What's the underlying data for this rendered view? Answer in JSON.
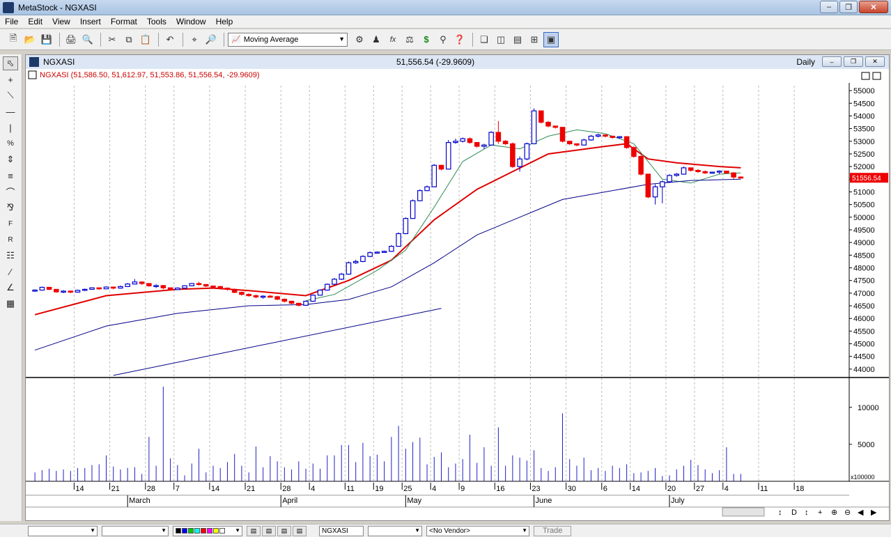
{
  "window": {
    "title": "MetaStock - NGXASI"
  },
  "menu": [
    "File",
    "Edit",
    "View",
    "Insert",
    "Format",
    "Tools",
    "Window",
    "Help"
  ],
  "toolbar": {
    "indicator_select": "Moving Average"
  },
  "chart_window": {
    "name": "NGXASI",
    "last_value": "51,556.54 (-29.9609)",
    "period": "Daily",
    "price_header": "NGXASI (51,586.50, 51,612.97, 51,553.86, 51,556.54, -29.9609)",
    "last_price_tag": "51556.54",
    "volume_scale": "x100000"
  },
  "bottom": {
    "symbol": "NGXASI",
    "vendor": "<No Vendor>",
    "trade": "Trade"
  },
  "colors": {
    "up": "#0000cc",
    "down": "#ee0000",
    "ma_red": "#e00000",
    "ma_green": "#2e8b57",
    "ma_blue": "#000088",
    "volume": "#1f1fc8"
  },
  "chart_data": {
    "type": "candlestick",
    "price_axis": {
      "min": 43750,
      "max": 55250,
      "ticks": [
        44000,
        44500,
        45000,
        45500,
        46000,
        46500,
        47000,
        47500,
        48000,
        48500,
        49000,
        49500,
        50000,
        50500,
        51000,
        51500,
        52000,
        52500,
        53000,
        53500,
        54000,
        54500,
        55000
      ]
    },
    "volume_axis": {
      "min": 0,
      "max": 13000,
      "ticks": [
        5000,
        10000
      ]
    },
    "day_labels": [
      "14",
      "21",
      "28",
      "7",
      "14",
      "21",
      "28",
      "4",
      "11",
      "19",
      "25",
      "4",
      "9",
      "16",
      "23",
      "30",
      "6",
      "14",
      "20",
      "27",
      "4",
      "11",
      "18"
    ],
    "month_labels": [
      "March",
      "April",
      "May",
      "June",
      "July"
    ],
    "candles": [
      [
        47080,
        47150,
        47050,
        47120,
        1200
      ],
      [
        47120,
        47260,
        47100,
        47230,
        1500
      ],
      [
        47230,
        47240,
        47120,
        47150,
        1700
      ],
      [
        47150,
        47160,
        47020,
        47050,
        1400
      ],
      [
        47050,
        47120,
        47000,
        47080,
        1600
      ],
      [
        47080,
        47100,
        47000,
        47040,
        1400
      ],
      [
        47040,
        47140,
        47020,
        47110,
        1800
      ],
      [
        47110,
        47180,
        47080,
        47150,
        1800
      ],
      [
        47150,
        47230,
        47130,
        47210,
        2200
      ],
      [
        47210,
        47220,
        47130,
        47170,
        2300
      ],
      [
        47170,
        47270,
        47160,
        47240,
        3500
      ],
      [
        47240,
        47260,
        47150,
        47200,
        2000
      ],
      [
        47200,
        47300,
        47180,
        47260,
        1600
      ],
      [
        47260,
        47400,
        47240,
        47360,
        1800
      ],
      [
        47360,
        47560,
        47340,
        47440,
        1900
      ],
      [
        47440,
        47460,
        47320,
        47380,
        1000
      ],
      [
        47380,
        47390,
        47250,
        47290,
        6000
      ],
      [
        47290,
        47350,
        47200,
        47300,
        2100
      ],
      [
        47300,
        47320,
        47150,
        47210,
        12800
      ],
      [
        47210,
        47220,
        47100,
        47140,
        3100
      ],
      [
        47140,
        47230,
        47120,
        47200,
        2200
      ],
      [
        47200,
        47310,
        47170,
        47290,
        800
      ],
      [
        47290,
        47400,
        47270,
        47380,
        2400
      ],
      [
        47380,
        47450,
        47300,
        47340,
        4400
      ],
      [
        47340,
        47360,
        47240,
        47280,
        1200
      ],
      [
        47280,
        47300,
        47200,
        47260,
        2100
      ],
      [
        47260,
        47290,
        47150,
        47200,
        1800
      ],
      [
        47200,
        47220,
        47100,
        47150,
        2600
      ],
      [
        47150,
        47180,
        47000,
        47030,
        3700
      ],
      [
        47030,
        47060,
        46900,
        46950,
        2100
      ],
      [
        46950,
        47000,
        46860,
        46900,
        1200
      ],
      [
        46900,
        46950,
        46800,
        46850,
        4700
      ],
      [
        46850,
        46920,
        46780,
        46880,
        1900
      ],
      [
        46880,
        46930,
        46820,
        46860,
        3400
      ],
      [
        46860,
        46900,
        46720,
        46760,
        2700
      ],
      [
        46760,
        46790,
        46630,
        46680,
        1900
      ],
      [
        46680,
        46700,
        46560,
        46600,
        1600
      ],
      [
        46600,
        46620,
        46480,
        46520,
        2700
      ],
      [
        46520,
        46700,
        46500,
        46680,
        1700
      ],
      [
        46680,
        46950,
        46660,
        46920,
        2400
      ],
      [
        46920,
        47150,
        46900,
        47120,
        1700
      ],
      [
        47120,
        47380,
        47100,
        47350,
        3500
      ],
      [
        47350,
        47600,
        47330,
        47550,
        3500
      ],
      [
        47550,
        47800,
        47520,
        47750,
        4900
      ],
      [
        47750,
        48250,
        47730,
        48200,
        4900
      ],
      [
        48200,
        48320,
        48150,
        48250,
        2600
      ],
      [
        48250,
        48500,
        48220,
        48450,
        5200
      ],
      [
        48450,
        48650,
        48420,
        48600,
        3400
      ],
      [
        48600,
        48650,
        48580,
        48620,
        3600
      ],
      [
        48620,
        48680,
        48600,
        48650,
        2700
      ],
      [
        48650,
        48900,
        48630,
        48850,
        6000
      ],
      [
        48850,
        49400,
        48830,
        49350,
        7500
      ],
      [
        49350,
        50000,
        49330,
        49950,
        4400
      ],
      [
        49950,
        50700,
        49930,
        50650,
        5300
      ],
      [
        50650,
        51100,
        50630,
        51050,
        5900
      ],
      [
        51050,
        51250,
        51030,
        51200,
        2300
      ],
      [
        51200,
        52100,
        51180,
        52050,
        3300
      ],
      [
        52050,
        52000,
        51850,
        51900,
        3900
      ],
      [
        51900,
        53050,
        51880,
        52950,
        1900
      ],
      [
        52950,
        53100,
        52900,
        53000,
        2400
      ],
      [
        53000,
        53150,
        52950,
        53100,
        3000
      ],
      [
        53100,
        53150,
        52900,
        52950,
        6300
      ],
      [
        52950,
        52950,
        52750,
        52800,
        2500
      ],
      [
        52800,
        52900,
        52700,
        52850,
        4600
      ],
      [
        52850,
        53400,
        52830,
        53350,
        2100
      ],
      [
        53350,
        53800,
        52900,
        53000,
        7300
      ],
      [
        53000,
        53050,
        52850,
        52900,
        2100
      ],
      [
        52900,
        52950,
        51950,
        52000,
        3500
      ],
      [
        52000,
        52400,
        51800,
        52300,
        3200
      ],
      [
        52300,
        52950,
        52250,
        52900,
        2800
      ],
      [
        52900,
        54300,
        52880,
        54200,
        4200
      ],
      [
        54200,
        54100,
        53700,
        53750,
        1800
      ],
      [
        53750,
        53800,
        53550,
        53600,
        1400
      ],
      [
        53600,
        53600,
        53500,
        53550,
        1900
      ],
      [
        53550,
        53500,
        52950,
        53000,
        9200
      ],
      [
        53000,
        53000,
        52850,
        52900,
        3000
      ],
      [
        52900,
        52900,
        52800,
        52850,
        2100
      ],
      [
        52850,
        53100,
        52830,
        53050,
        3200
      ],
      [
        53050,
        53250,
        53020,
        53200,
        1500
      ],
      [
        53200,
        53300,
        53150,
        53250,
        1800
      ],
      [
        53250,
        53250,
        53150,
        53200,
        1400
      ],
      [
        53200,
        53200,
        53100,
        53150,
        2100
      ],
      [
        53150,
        53200,
        53100,
        53180,
        1800
      ],
      [
        53180,
        53200,
        52700,
        52750,
        2300
      ],
      [
        52750,
        52800,
        52350,
        52400,
        1100
      ],
      [
        52400,
        52450,
        51650,
        51700,
        1200
      ],
      [
        51700,
        51700,
        50750,
        50800,
        1400
      ],
      [
        50800,
        51300,
        50500,
        51200,
        1800
      ],
      [
        51200,
        51450,
        50550,
        51400,
        700
      ],
      [
        51400,
        51700,
        51350,
        51650,
        800
      ],
      [
        51650,
        51750,
        51600,
        51700,
        1600
      ],
      [
        51700,
        52000,
        51680,
        51950,
        2100
      ],
      [
        51950,
        51950,
        51800,
        51850,
        2900
      ],
      [
        51850,
        51900,
        51750,
        51800,
        2200
      ],
      [
        51800,
        51850,
        51700,
        51750,
        1600
      ],
      [
        51750,
        51800,
        51720,
        51780,
        1100
      ],
      [
        51780,
        51850,
        51700,
        51820,
        1500
      ],
      [
        51820,
        51830,
        51700,
        51750,
        4600
      ],
      [
        51750,
        51780,
        51500,
        51586,
        1000
      ],
      [
        51586.5,
        51612.97,
        51553.86,
        51556.54,
        1000
      ]
    ],
    "ma_lines": [
      {
        "color": "#e00000",
        "width": 2,
        "points": [
          [
            0,
            46150
          ],
          [
            10,
            46900
          ],
          [
            20,
            47150
          ],
          [
            25,
            47200
          ],
          [
            30,
            47100
          ],
          [
            38,
            46900
          ],
          [
            44,
            47500
          ],
          [
            50,
            48300
          ],
          [
            56,
            49900
          ],
          [
            62,
            51100
          ],
          [
            67,
            51800
          ],
          [
            72,
            52500
          ],
          [
            80,
            52800
          ],
          [
            83,
            52900
          ],
          [
            86,
            52300
          ],
          [
            90,
            52150
          ],
          [
            96,
            52000
          ],
          [
            99,
            51950
          ]
        ]
      },
      {
        "color": "#2e8b57",
        "width": 1,
        "points": [
          [
            38,
            46700
          ],
          [
            42,
            46950
          ],
          [
            48,
            47900
          ],
          [
            52,
            48700
          ],
          [
            56,
            50400
          ],
          [
            60,
            52200
          ],
          [
            64,
            52850
          ],
          [
            68,
            52700
          ],
          [
            72,
            53200
          ],
          [
            76,
            53450
          ],
          [
            80,
            53300
          ],
          [
            84,
            52900
          ],
          [
            88,
            51500
          ],
          [
            92,
            51350
          ],
          [
            96,
            51700
          ],
          [
            99,
            51750
          ]
        ]
      },
      {
        "color": "#000088",
        "width": 1,
        "points": [
          [
            0,
            44750
          ],
          [
            10,
            45700
          ],
          [
            20,
            46200
          ],
          [
            30,
            46500
          ],
          [
            38,
            46550
          ],
          [
            44,
            46750
          ],
          [
            50,
            47250
          ],
          [
            56,
            48200
          ],
          [
            62,
            49300
          ],
          [
            68,
            50000
          ],
          [
            74,
            50700
          ],
          [
            80,
            51000
          ],
          [
            86,
            51300
          ],
          [
            92,
            51450
          ],
          [
            99,
            51500
          ]
        ]
      },
      {
        "color": "#000088",
        "width": 1,
        "points": [
          [
            11,
            43750
          ],
          [
            57,
            46400
          ]
        ]
      }
    ]
  }
}
